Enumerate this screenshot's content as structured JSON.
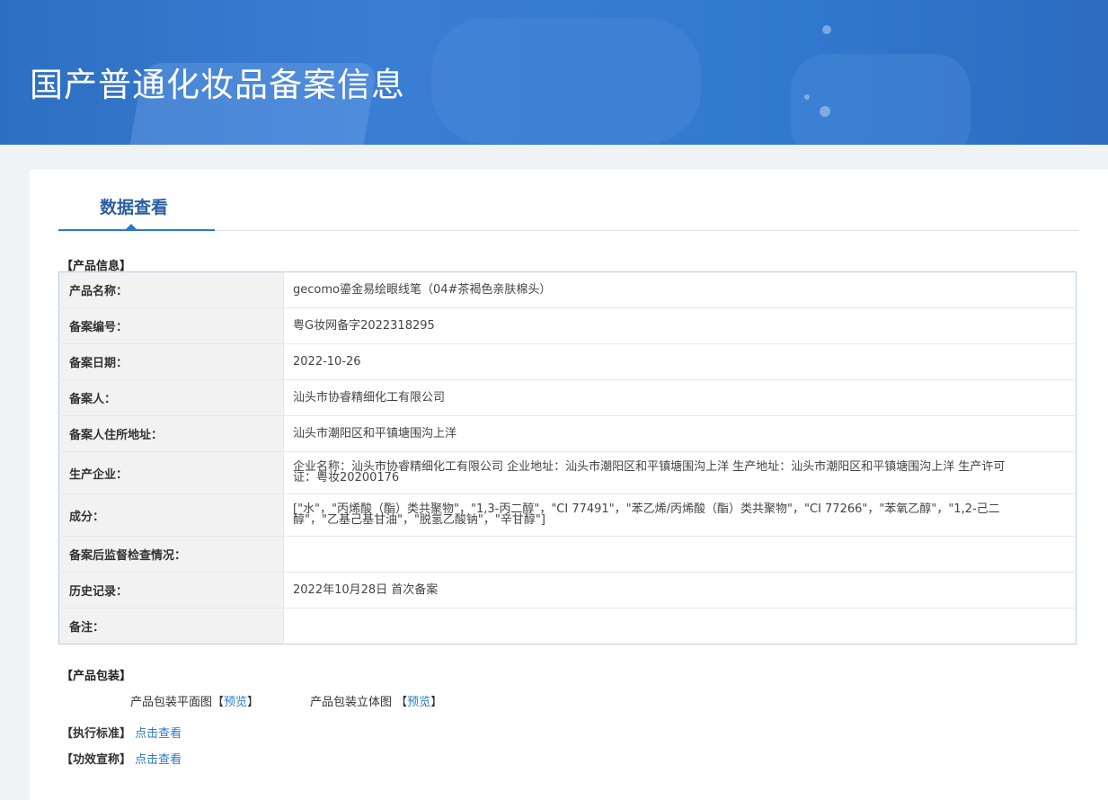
{
  "header": {
    "title": "国产普通化妆品备案信息"
  },
  "tab": {
    "label": "数据查看"
  },
  "product_info": {
    "section_label": "【产品信息】",
    "rows": [
      {
        "key": "产品名称：",
        "value": "gecomo鎏金易绘眼线笔（04#茶褐色亲肤棉头）"
      },
      {
        "key": "备案编号：",
        "value": "粤G妆网备字2022318295"
      },
      {
        "key": "备案日期：",
        "value": "2022-10-26"
      },
      {
        "key": "备案人：",
        "value": "汕头市协睿精细化工有限公司"
      },
      {
        "key": "备案人住所地址：",
        "value": "汕头市潮阳区和平镇塘围沟上洋"
      },
      {
        "key": "生产企业：",
        "value": "企业名称：汕头市协睿精细化工有限公司 企业地址：汕头市潮阳区和平镇塘围沟上洋 生产地址：汕头市潮阳区和平镇塘围沟上洋 生产许可证：粤妆20200176"
      },
      {
        "key": "成分：",
        "value": "[\"水\"，\"丙烯酸（酯）类共聚物\"，\"1,3-丙二醇\"，\"CI 77491\"，\"苯乙烯/丙烯酸（酯）类共聚物\"，\"CI 77266\"，\"苯氧乙醇\"，\"1,2-己二醇\"，\"乙基己基甘油\"，\"脱氢乙酸钠\"，\"辛甘醇\"]"
      },
      {
        "key": "备案后监督检查情况：",
        "value": ""
      },
      {
        "key": "历史记录：",
        "value": "2022年10月28日 首次备案"
      },
      {
        "key": "备注：",
        "value": ""
      }
    ]
  },
  "packaging": {
    "section_label": "【产品包装】",
    "flat_label": "产品包装平面图",
    "flat_link": "预览",
    "solid_label": "产品包装立体图",
    "solid_link": "预览"
  },
  "standard": {
    "section_label": "【执行标准】",
    "link": "点击查看"
  },
  "efficacy": {
    "section_label": "【功效宣称】",
    "link": "点击查看"
  },
  "colors": {
    "banner": "#3179cf",
    "accent": "#2a79c9",
    "link": "#2a7ac6",
    "key_bg": "#f2f2f2"
  }
}
